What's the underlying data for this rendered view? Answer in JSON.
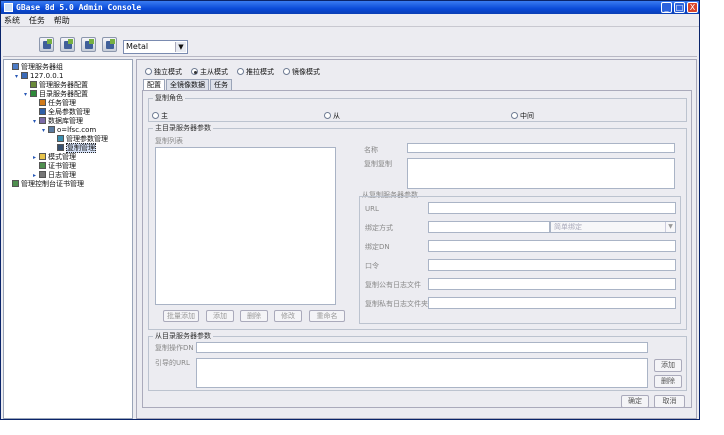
{
  "window": {
    "title": "GBase 8d 5.0 Admin Console",
    "min": "_",
    "max": "□",
    "close": "X"
  },
  "menu": [
    "系统",
    "任务",
    "帮助"
  ],
  "toolbar": {
    "look_and_feel": "Metal"
  },
  "tree": [
    {
      "label": "管理服务器组",
      "level": 0,
      "icon": "server-group-icon",
      "toggle": ""
    },
    {
      "label": "127.0.0.1",
      "level": 1,
      "icon": "server-icon",
      "toggle": "▾"
    },
    {
      "label": "管理服务器配置",
      "level": 2,
      "icon": "config-icon",
      "toggle": ""
    },
    {
      "label": "目录服务器配置",
      "level": 2,
      "icon": "directory-icon",
      "toggle": "▾"
    },
    {
      "label": "任务管理",
      "level": 3,
      "icon": "tools-icon",
      "toggle": ""
    },
    {
      "label": "全局参数管理",
      "level": 3,
      "icon": "globe-icon",
      "toggle": ""
    },
    {
      "label": "数据库管理",
      "level": 3,
      "icon": "database-icon",
      "toggle": "▾"
    },
    {
      "label": "o=lfsc.com",
      "level": 4,
      "icon": "node-icon",
      "toggle": "▾"
    },
    {
      "label": "管理参数管理",
      "level": 5,
      "icon": "param-icon",
      "toggle": ""
    },
    {
      "label": "复制管理",
      "level": 5,
      "icon": "replication-icon",
      "toggle": "",
      "selected": true
    },
    {
      "label": "模式管理",
      "level": 3,
      "icon": "folder-icon",
      "toggle": "▸"
    },
    {
      "label": "证书管理",
      "level": 3,
      "icon": "certificate-icon",
      "toggle": ""
    },
    {
      "label": "日志管理",
      "level": 3,
      "icon": "log-icon",
      "toggle": "▸"
    },
    {
      "label": "管理控制台证书管理",
      "level": 0,
      "icon": "certificate-icon",
      "toggle": ""
    }
  ],
  "modes": [
    {
      "label": "独立模式",
      "on": false
    },
    {
      "label": "主从模式",
      "on": true
    },
    {
      "label": "推拉模式",
      "on": false
    },
    {
      "label": "镜像模式",
      "on": false
    }
  ],
  "tabs": [
    "配置",
    "全镜像数据",
    "任务"
  ],
  "role": {
    "group_label": "复制角色",
    "master": "主",
    "slave": "从",
    "middle": "中间"
  },
  "master_params": {
    "group_label": "主目录服务器参数",
    "list_label": "复制列表",
    "name_label": "名称",
    "replica_label": "复制复制",
    "buttons": {
      "batch_add": "批量添加",
      "add": "添加",
      "delete": "删除",
      "modify": "修改",
      "rename": "重命名"
    },
    "slave_group_label": "从复制服务器参数",
    "url_label": "URL",
    "bind_method_label": "绑定方式",
    "bind_method_value": "简单绑定",
    "bind_dn_label": "绑定DN",
    "password_label": "口令",
    "public_log_label": "复制公有日志文件",
    "private_log_label": "复制私有日志文件夹"
  },
  "slave_params": {
    "group_label": "从目录服务器参数",
    "dn_label": "复制操作DN",
    "url_label": "引导的URL",
    "add": "添加",
    "delete": "删除"
  },
  "footer": {
    "ok": "确定",
    "cancel": "取消"
  }
}
